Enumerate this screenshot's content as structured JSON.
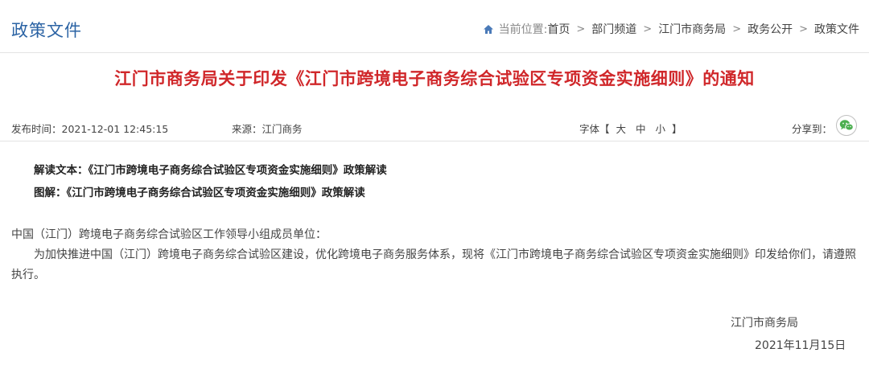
{
  "header": {
    "section_title": "政策文件",
    "breadcrumb": {
      "prefix": "当前位置:",
      "items": [
        "首页",
        "部门频道",
        "江门市商务局",
        "政务公开",
        "政策文件"
      ],
      "separator": ">"
    }
  },
  "article": {
    "title": "江门市商务局关于印发《江门市跨境电子商务综合试验区专项资金实施细则》的通知",
    "meta": {
      "publish_time": "发布时间：2021-12-01 12:45:15",
      "source": "来源：江门商务",
      "font_label": "字体【",
      "font_large": "大",
      "font_medium": "中",
      "font_small": "小",
      "font_label_end": "】",
      "share_label": "分享到："
    },
    "related": [
      {
        "label": "解读文本：",
        "link": "《江门市跨境电子商务综合试验区专项资金实施细则》政策解读"
      },
      {
        "label": "图解：",
        "link": "《江门市跨境电子商务综合试验区专项资金实施细则》政策解读"
      }
    ],
    "addressee": "中国（江门）跨境电子商务综合试验区工作领导小组成员单位：",
    "body": "为加快推进中国（江门）跨境电子商务综合试验区建设，优化跨境电子商务服务体系，现将《江门市跨境电子商务综合试验区专项资金实施细则》印发给你们，请遵照执行。",
    "signature": "江门市商务局",
    "date": "2021年11月15日"
  },
  "colors": {
    "section_title": "#2b63a4",
    "article_title": "#d0272a",
    "wechat": "#4caf50"
  },
  "icons": [
    "home-icon",
    "wechat-icon"
  ]
}
